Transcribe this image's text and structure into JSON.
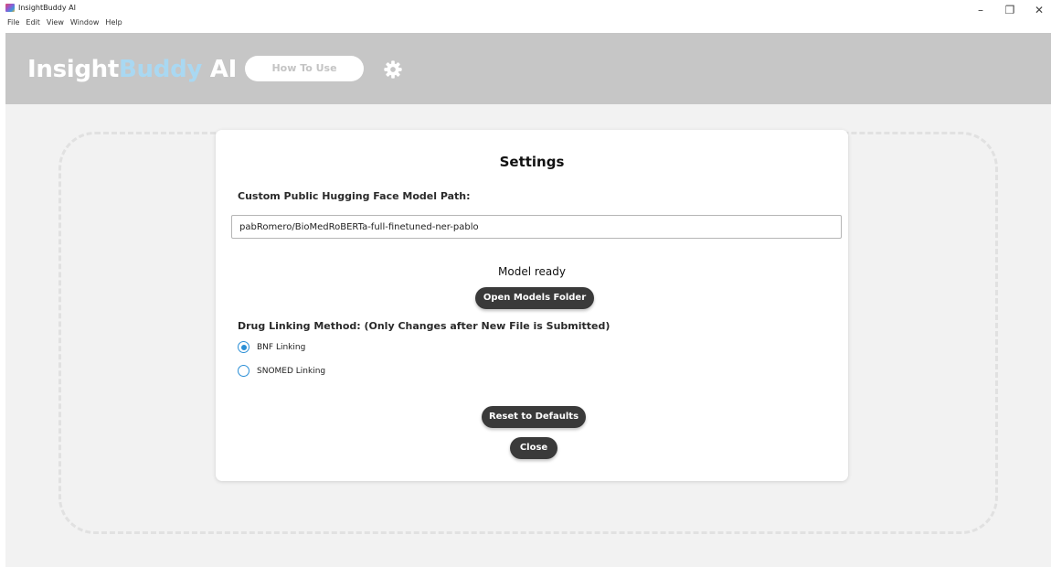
{
  "window": {
    "title": "InsightBuddy AI",
    "controls": {
      "minimize": "–",
      "restore": "❐",
      "close": "✕"
    }
  },
  "menu": [
    "File",
    "Edit",
    "View",
    "Window",
    "Help"
  ],
  "header": {
    "brand_part1": "Insight",
    "brand_part2": "Buddy",
    "brand_part3": "AI",
    "how_to_label": "How To Use",
    "settings_icon": "gear-icon",
    "colors": {
      "header_bg": "#c6c6c6",
      "brand_accent": "#a9d8f2"
    }
  },
  "settings": {
    "title": "Settings",
    "model_path_label": "Custom Public Hugging Face Model Path:",
    "model_path_value": "pabRomero/BioMedRoBERTa-full-finetuned-ner-pablo",
    "status": "Model ready",
    "open_models_label": "Open Models Folder",
    "drug_linking_label": "Drug Linking Method: (Only Changes after New File is Submitted)",
    "options": [
      {
        "label": "BNF Linking",
        "checked": true
      },
      {
        "label": "SNOMED Linking",
        "checked": false
      }
    ],
    "reset_label": "Reset to Defaults",
    "close_label": "Close",
    "colors": {
      "radio": "#2b8fd6",
      "button_bg": "#3a3a3a"
    }
  }
}
